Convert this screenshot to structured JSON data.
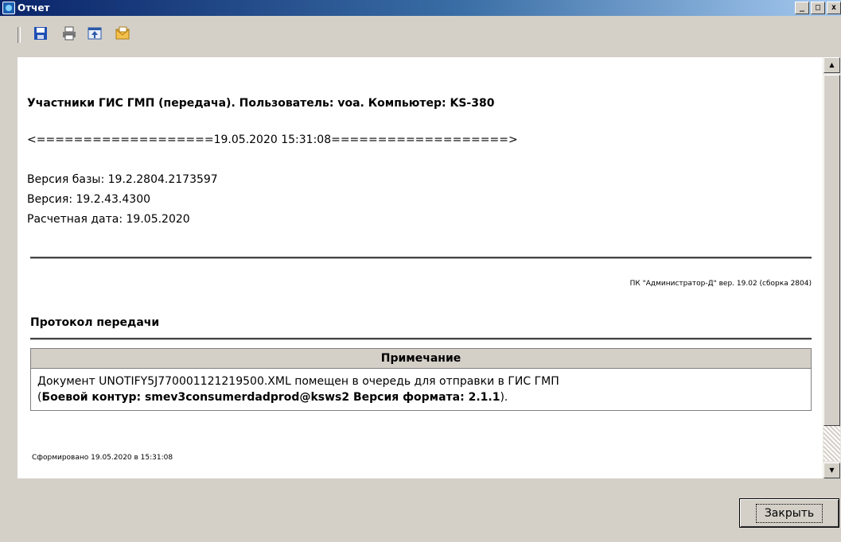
{
  "window": {
    "title": "Отчет",
    "controls": [
      "_",
      "□",
      "x"
    ]
  },
  "toolbar": {
    "buttons": [
      {
        "name": "save",
        "icon": "floppy-disk-icon"
      },
      {
        "name": "print",
        "icon": "printer-icon"
      },
      {
        "name": "export",
        "icon": "export-icon"
      },
      {
        "name": "email",
        "icon": "envelope-icon"
      }
    ]
  },
  "report": {
    "title": "Участники ГИС ГМП (передача). Пользователь: voa. Компьютер: KS-380",
    "separator_line": "<===================19.05.2020 15:31:08===================>",
    "info": [
      "Версия базы: 19.2.2804.2173597",
      "Версия: 19.2.43.4300",
      "Расчетная дата: 19.05.2020"
    ],
    "program_label": "ПК \"Администратор-Д\" вер. 19.02 (сборка 2804)",
    "section_title": "Протокол передачи",
    "table": {
      "header": "Примечание",
      "row_text": "Документ UNOTIFY5J770001121219500.XML помещен в очередь для отправки в ГИС ГМП",
      "row_open_paren": "(",
      "row_bold": "Боевой контур: smev3consumerdadprod@ksws2 Версия формата: 2.1.1",
      "row_close": ")."
    },
    "generated": "Сформировано 19.05.2020 в 15:31:08"
  },
  "buttons": {
    "close": "Закрыть"
  },
  "colors": {
    "titlebar_start": "#0a246a",
    "titlebar_end": "#a6caf0",
    "window_bg": "#d4d0c8"
  }
}
